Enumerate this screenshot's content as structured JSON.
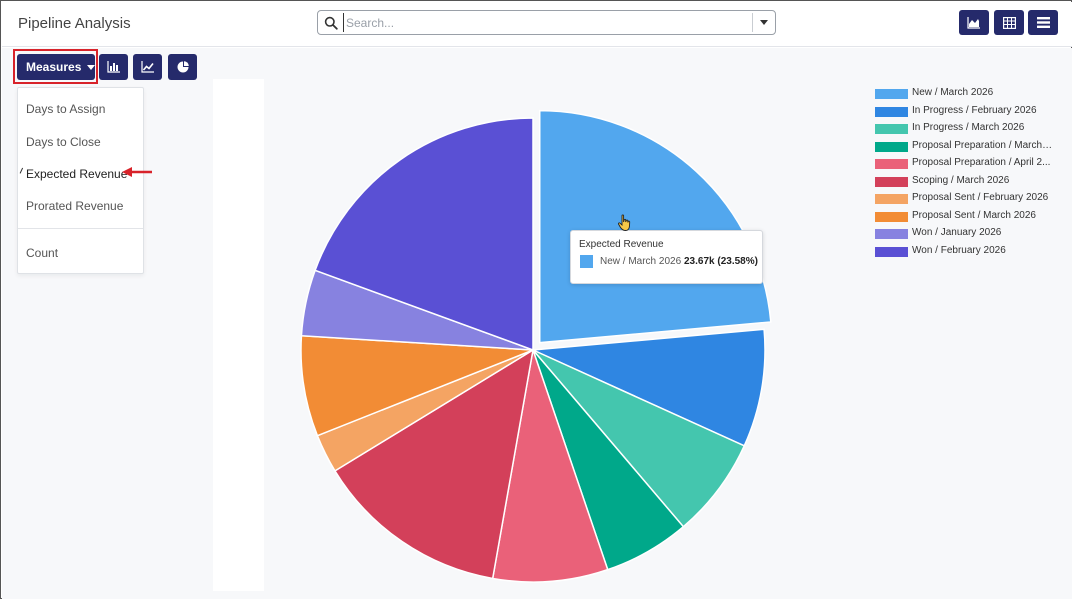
{
  "app": {
    "title": "Pipeline Analysis"
  },
  "search": {
    "placeholder": "Search...",
    "value": ""
  },
  "toolbar": {
    "measures_label": "Measures",
    "view_buttons": [
      "area-chart-icon",
      "table-grid-icon",
      "list-icon"
    ],
    "chart_buttons": [
      "bar-chart-icon",
      "line-chart-icon",
      "pie-chart-icon"
    ]
  },
  "measures_menu": {
    "items": [
      {
        "label": "Days to Assign",
        "selected": false
      },
      {
        "label": "Days to Close",
        "selected": false
      },
      {
        "label": "Expected Revenue",
        "selected": true
      },
      {
        "label": "Prorated Revenue",
        "selected": false
      },
      {
        "label": "Count",
        "selected": false
      }
    ]
  },
  "tooltip": {
    "title": "Expected Revenue",
    "label": "New / March 2026",
    "value": "23.67k (23.58%)",
    "color": "#52a7ee"
  },
  "chart_data": {
    "type": "pie",
    "measure": "Expected Revenue",
    "highlighted": "New / March 2026",
    "slices": [
      {
        "name": "New / March 2026",
        "percent": 23.58,
        "color": "#52a7ee"
      },
      {
        "name": "In Progress / February 2026",
        "percent": 8.2,
        "color": "#2f86e2"
      },
      {
        "name": "In Progress / March 2026",
        "percent": 7.0,
        "color": "#44c6ae"
      },
      {
        "name": "Proposal Preparation / March 2...",
        "percent": 6.0,
        "color": "#00a88a"
      },
      {
        "name": "Proposal Preparation / April 2...",
        "percent": 8.0,
        "color": "#ea6179"
      },
      {
        "name": "Scoping / March 2026",
        "percent": 13.5,
        "color": "#d3405a"
      },
      {
        "name": "Proposal Sent / February 2026",
        "percent": 2.7,
        "color": "#f4a463"
      },
      {
        "name": "Proposal Sent / March 2026",
        "percent": 7.0,
        "color": "#f28c35"
      },
      {
        "name": "Won / January 2026",
        "percent": 4.6,
        "color": "#8782e0"
      },
      {
        "name": "Won / February 2026",
        "percent": 19.42,
        "color": "#5a50d4"
      }
    ]
  }
}
